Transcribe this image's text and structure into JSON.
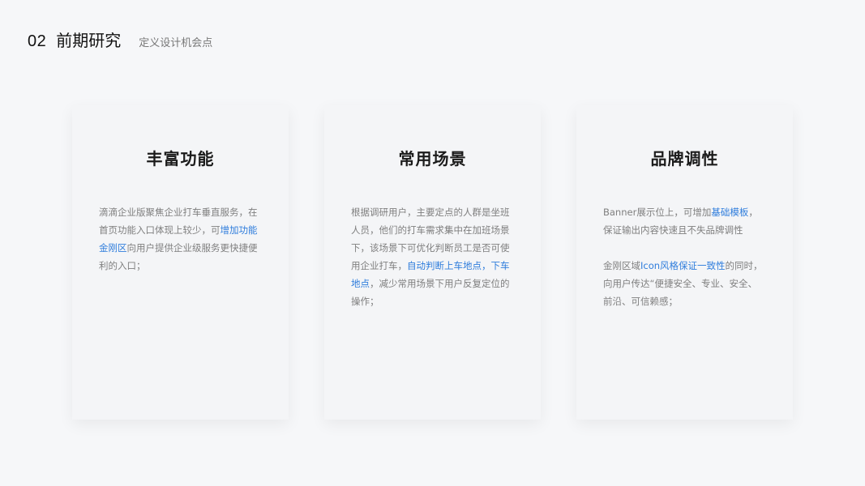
{
  "header": {
    "number": "02",
    "title": "前期研究",
    "subtitle": "定义设计机会点"
  },
  "cards": [
    {
      "title": "丰富功能",
      "paragraphs": [
        [
          {
            "text": "滴滴企业版聚焦企业打车垂直服务，在首页功能入口体现上较少，可",
            "highlight": false
          },
          {
            "text": "增加功能金刚区",
            "highlight": true
          },
          {
            "text": "向用户提供企业级服务更快捷便利的入口；",
            "highlight": false
          }
        ]
      ]
    },
    {
      "title": "常用场景",
      "paragraphs": [
        [
          {
            "text": "根据调研用户，主要定点的人群是坐班人员，他们的打车需求集中在加班场景下，该场景下可优化判断员工是否可使用企业打车，",
            "highlight": false
          },
          {
            "text": "自动判断上车地点，下车地点",
            "highlight": true
          },
          {
            "text": "，减少常用场景下用户反复定位的操作；",
            "highlight": false
          }
        ]
      ]
    },
    {
      "title": "品牌调性",
      "paragraphs": [
        [
          {
            "text": "Banner展示位上，可增加",
            "highlight": false
          },
          {
            "text": "基础模板",
            "highlight": true
          },
          {
            "text": "，保证输出内容快速且不失品牌调性",
            "highlight": false
          }
        ],
        [
          {
            "text": "金刚区域",
            "highlight": false
          },
          {
            "text": "Icon风格保证一致性",
            "highlight": true
          },
          {
            "text": "的同时，向用户传达“便捷安全、专业、安全、前沿、可信赖感；",
            "highlight": false
          }
        ]
      ]
    }
  ],
  "colors": {
    "background": "#f6f7f9",
    "card": "#f4f5f7",
    "highlight": "#2f7ddc",
    "body_text": "#7f7f7f"
  }
}
